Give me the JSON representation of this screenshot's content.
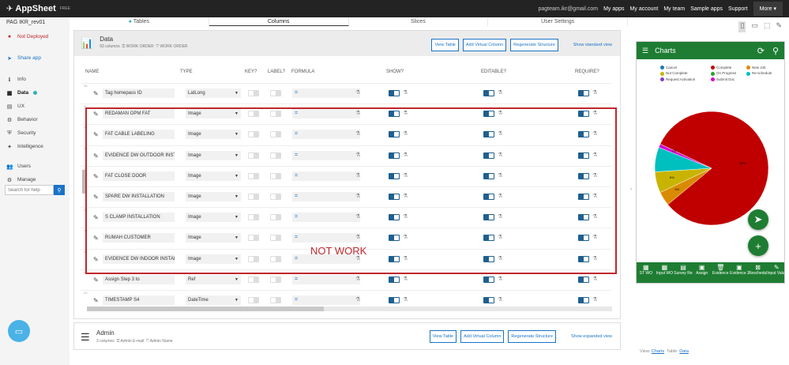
{
  "top": {
    "brand": "AppSheet",
    "free": "FREE",
    "user": "pagteam.ikr@gmail.com",
    "links": [
      "My apps",
      "My account",
      "My team",
      "Sample apps",
      "Support"
    ],
    "more": "More"
  },
  "sidebar": {
    "app_name": "PAG IKR_rev01",
    "not_deployed": "Not Deployed",
    "share": "Share app",
    "items": [
      {
        "label": "Info",
        "icon": "info-icon"
      },
      {
        "label": "Data",
        "icon": "grid-icon"
      },
      {
        "label": "UX",
        "icon": "ux-icon"
      },
      {
        "label": "Behavior",
        "icon": "behavior-icon"
      },
      {
        "label": "Security",
        "icon": "shield-icon"
      },
      {
        "label": "Intelligence",
        "icon": "bulb-icon"
      },
      {
        "label": "Users",
        "icon": "users-icon"
      },
      {
        "label": "Manage",
        "icon": "gear-icon"
      }
    ],
    "search_placeholder": "Search for help"
  },
  "tabs": [
    "Tables",
    "Columns",
    "Slices",
    "User Settings"
  ],
  "table": {
    "name": "Data",
    "meta": "93 columns",
    "tag1": "WORK ORDER",
    "tag2": "WORK ORDER",
    "view_table": "View Table",
    "add_virtual": "Add Virtual Column",
    "regenerate": "Regenerate Structure",
    "show_standard": "Show standard view"
  },
  "columns_header": {
    "name": "NAME",
    "type": "TYPE",
    "key": "KEY?",
    "label": "LABEL?",
    "formula": "FORMULA",
    "show": "SHOW?",
    "editable": "EDITABLE?",
    "require": "REQUIRE?"
  },
  "rows": [
    {
      "num": "38",
      "name": "Tag homepass ID",
      "type": "LatLong"
    },
    {
      "num": "40",
      "name": "REDAMAN OPM FAT",
      "type": "Image"
    },
    {
      "num": "41",
      "name": "FAT CABLE LABELING",
      "type": "Image"
    },
    {
      "num": "42",
      "name": "EVIDENCE DW OUTDOOR INSTA",
      "type": "Image"
    },
    {
      "num": "43",
      "name": "FAT CLOSE DOOR",
      "type": "Image"
    },
    {
      "num": "44",
      "name": "SPARE DW INSTALLATION",
      "type": "Image"
    },
    {
      "num": "45",
      "name": "S CLAMP INSTALLATION",
      "type": "Image"
    },
    {
      "num": "46",
      "name": "RUMAH CUSTOMER",
      "type": "Image"
    },
    {
      "num": "47",
      "name": "EVIDENCE DW INDOOR INSTALI",
      "type": "Image"
    },
    {
      "num": "48",
      "name": "Assign Step 3 to",
      "type": "Ref"
    },
    {
      "num": "49",
      "name": "TIMESTAMP S4",
      "type": "DateTime"
    }
  ],
  "annotation": "NOT WORK",
  "formula_symbol": "=",
  "admin": {
    "name": "Admin",
    "meta": "3 columns",
    "tag1": "Admin E-mail",
    "tag2": "Admin Name",
    "view_table": "View Table",
    "add_virtual": "Add Virtual Column",
    "regenerate": "Regenerate Structure",
    "show_expanded": "Show expanded view"
  },
  "preview": {
    "title": "Charts",
    "legend": [
      {
        "label": "Cancel",
        "color": "#1f77b4"
      },
      {
        "label": "Complete",
        "color": "#c00000"
      },
      {
        "label": "New Job",
        "color": "#d98a00"
      },
      {
        "label": "Not Complete",
        "color": "#c8b400"
      },
      {
        "label": "On Progress",
        "color": "#2ca02c"
      },
      {
        "label": "Re-schedule",
        "color": "#00bfbf"
      },
      {
        "label": "Request Activation",
        "color": "#7f3fbf"
      },
      {
        "label": "Submit Doc",
        "color": "#d400d4"
      }
    ],
    "pie_labels": [
      "82%",
      "4%",
      "6%",
      "1%"
    ],
    "nav": [
      "ST WO",
      "Input WO",
      "Survey Report",
      "Assign",
      "Evidence",
      "Evidence 2",
      "Reschedule Cancel",
      "Input Value"
    ],
    "footer_view": "View:",
    "footer_view_val": "Charts",
    "footer_table": "Table:",
    "footer_table_val": "Data"
  },
  "chart_data": {
    "type": "pie",
    "categories": [
      "Complete",
      "New Job",
      "Not Complete",
      "Re-schedule",
      "Submit Doc"
    ],
    "values": [
      82,
      4,
      6,
      7,
      1
    ],
    "labels": [
      "82%",
      "4%",
      "6%",
      "",
      "1%"
    ]
  }
}
